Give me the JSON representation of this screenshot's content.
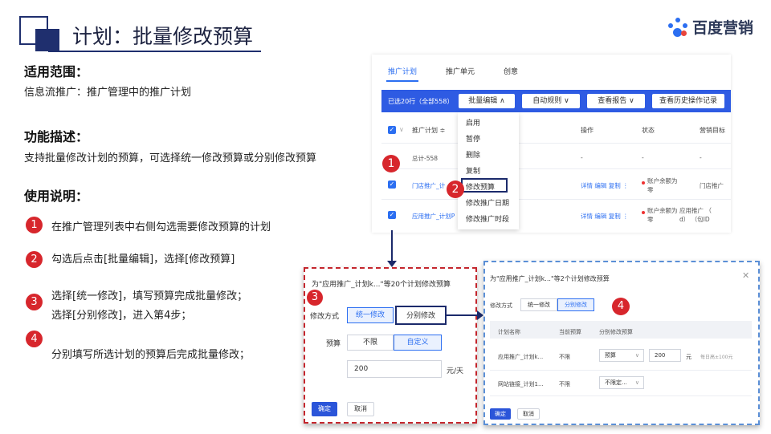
{
  "header": {
    "title": "计划：批量修改预算",
    "logo_text": "百度营销"
  },
  "left": {
    "scope_heading": "适用范围：",
    "scope_text": "信息流推广：推广管理中的推广计划",
    "function_heading": "功能描述：",
    "function_text": "支持批量修改计划的预算，可选择统一修改预算或分别修改预算",
    "usage_heading": "使用说明：",
    "steps": [
      {
        "num": "1",
        "line1": "在推广管理列表中右侧勾选需要修改预算的计划",
        "line2": ""
      },
      {
        "num": "2",
        "line1": "勾选后点击[批量编辑]，选择[修改预算]",
        "line2": ""
      },
      {
        "num": "3",
        "line1": "选择[统一修改]，填写预算完成批量修改；",
        "line2": "选择[分别修改]，进入第4步；"
      },
      {
        "num": "4",
        "line1": "分别填写所选计划的预算后完成批量修改；",
        "line2": ""
      }
    ]
  },
  "screenshot1": {
    "tabs": [
      "推广计划",
      "推广单元",
      "创意"
    ],
    "selected_text": "已选20行（全部558）",
    "toolbar": {
      "batch_edit": "批量编辑 ∧",
      "auto_rules": "自动规则 ∨",
      "view_report": "查看报告 ∨",
      "history": "查看历史操作记录"
    },
    "headers": {
      "plan": "推广计划 ≑",
      "ops": "操作",
      "status": "状态",
      "goal": "营销目标"
    },
    "total_row": {
      "name": "总计-558",
      "ops": "-",
      "status": "-",
      "goal": "-"
    },
    "rows": [
      {
        "name": "门店推广_计",
        "ops": "详情 编辑 复制 ⋮",
        "status_l1": "账户余额为",
        "status_l2": "零",
        "goal_l1": "门店推广",
        "goal_l2": ""
      },
      {
        "name": "应用推广_计划P",
        "ops": "详情 编辑 复制 ⋮",
        "status_l1": "账户余额为",
        "status_l2": "零",
        "goal_l1": "应用推广 （",
        "goal_l2": "d） （包ID"
      }
    ],
    "dropdown": [
      "启用",
      "暂停",
      "删除",
      "复制",
      "修改预算",
      "修改推广日期",
      "修改推广时段"
    ],
    "badges": [
      "1",
      "2"
    ]
  },
  "dialog1": {
    "badge": "3",
    "title": "为\"应用推广_计划k...\"等20个计划修改预算",
    "mode_label": "修改方式",
    "mode_options": [
      "统一修改",
      "分别修改"
    ],
    "budget_label": "预算",
    "budget_options": [
      "不限",
      "自定义"
    ],
    "budget_value": "200",
    "unit": "元/天",
    "confirm": "确定",
    "cancel": "取消"
  },
  "dialog2": {
    "badge": "4",
    "title": "为\"应用推广_计划k...\"等2个计划修改预算",
    "mode_label": "修改方式",
    "mode_options": [
      "统一修改",
      "分别修改"
    ],
    "columns": [
      "计划名称",
      "当前预算",
      "分别修改预算"
    ],
    "rows": [
      {
        "name": "应用推广_计划k...",
        "current": "不限",
        "select": "预算",
        "value": "200",
        "unit": "元",
        "hint": "每日高±100元"
      },
      {
        "name": "网站链接_计划1...",
        "current": "不限",
        "select": "不限定...",
        "value": "",
        "unit": "",
        "hint": ""
      }
    ],
    "confirm": "确定",
    "cancel": "取消"
  },
  "colors": {
    "navy": "#1f2f6e",
    "badge_red": "#d7262c",
    "accent_blue": "#2b6ef1",
    "toolbar_blue": "#2e5be3",
    "dash_red": "#c4262d",
    "dash_blue": "#5b8fd6"
  }
}
